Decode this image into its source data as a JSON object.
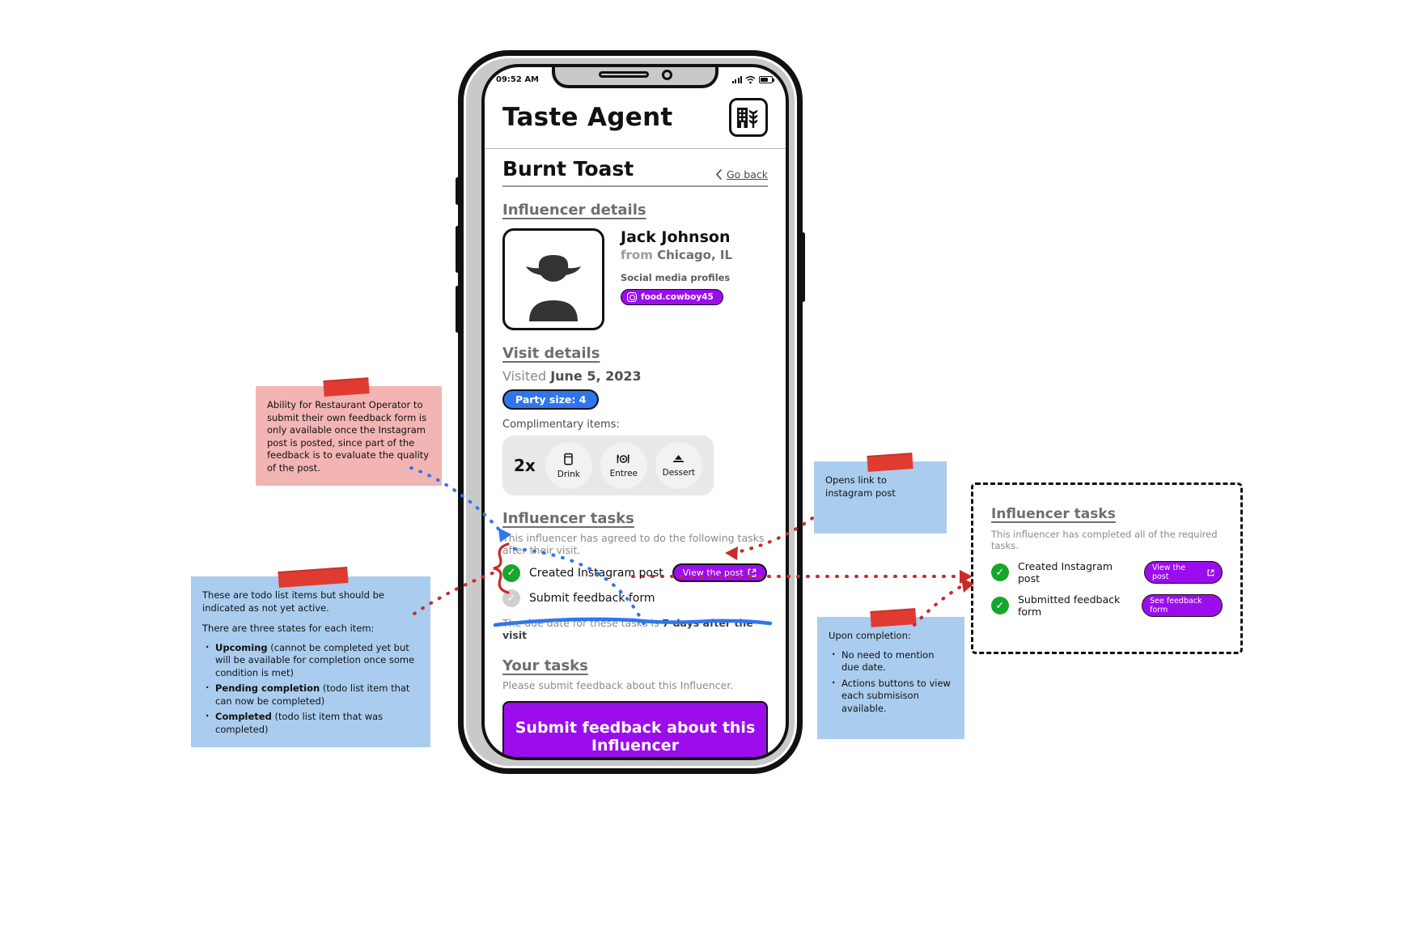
{
  "phone": {
    "status": {
      "time": "09:52 AM",
      "signal_icon": "signal-bars-icon",
      "wifi_icon": "wifi-icon",
      "battery_icon": "battery-icon"
    },
    "header": {
      "app_title": "Taste Agent",
      "logo_icon": "restaurant-logo-icon"
    },
    "page": {
      "title": "Burnt Toast",
      "back_label": "Go back",
      "back_icon": "chevron-left-icon"
    },
    "influencer": {
      "section_title": "Influencer details",
      "avatar_icon": "cowboy-avatar-icon",
      "name": "Jack Johnson",
      "from_prefix": "from ",
      "location": "Chicago, IL",
      "social_label": "Social media profiles",
      "social_handle": "food.cowboy45",
      "social_icon": "instagram-icon"
    },
    "visit": {
      "section_title": "Visit details",
      "visited_prefix": "Visited ",
      "visited_date": "June 5, 2023",
      "party_size_chip": "Party size: 4",
      "complimentary_label": "Complimentary items:",
      "quantity": "2x",
      "items": [
        {
          "label": "Drink",
          "icon": "cup-icon",
          "glyph": "🥤"
        },
        {
          "label": "Entree",
          "icon": "plate-icon",
          "glyph": "🍽"
        },
        {
          "label": "Dessert",
          "icon": "cake-slice-icon",
          "glyph": "🍰"
        }
      ]
    },
    "influencer_tasks": {
      "section_title": "Influencer tasks",
      "description": "This influencer has agreed to do the following tasks after their visit.",
      "rows": [
        {
          "label": "Created Instagram post",
          "state": "done",
          "check_icon": "check-circle-green-icon",
          "action_label": "View the post",
          "action_icon": "external-link-icon"
        },
        {
          "label": "Submit feedback form",
          "state": "todo",
          "check_icon": "check-circle-gray-icon",
          "action_label": "",
          "action_icon": ""
        }
      ],
      "due_prefix": "The due date for these tasks is ",
      "due_value": "7 days after the visit"
    },
    "your_tasks": {
      "section_title": "Your tasks",
      "description": "Please submit feedback about this Influencer.",
      "submit_label": "Submit feedback about this Influencer"
    }
  },
  "completed_panel": {
    "section_title": "Influencer tasks",
    "description": "This influencer has completed all of the required tasks.",
    "rows": [
      {
        "label": "Created Instagram post",
        "state": "done",
        "check_icon": "check-circle-green-icon",
        "action_label": "View the post",
        "action_icon": "external-link-icon"
      },
      {
        "label": "Submitted feedback form",
        "state": "done",
        "check_icon": "check-circle-green-icon",
        "action_label": "See feedback form",
        "action_icon": ""
      }
    ]
  },
  "notes": {
    "pink_feedback": {
      "text": "Ability for Restaurant Operator to submit their own feedback form is only available once the Instagram post is posted, since part of the feedback is to evaluate the quality of the post."
    },
    "blue_states": {
      "line1": "These are todo list items but should be indicated as not yet active.",
      "line2": "There are three states for each item:",
      "bullets": [
        {
          "bold": "Upcoming",
          "rest": " (cannot be completed yet but will be available for completion once some condition is met)"
        },
        {
          "bold": "Pending completion",
          "rest": " (todo list item that can now be completed)"
        },
        {
          "bold": "Completed",
          "rest": " (todo list item that was completed)"
        }
      ]
    },
    "opens_link": {
      "text": "Opens link to instagram post"
    },
    "upon_completion": {
      "title": "Upon completion:",
      "bullets": [
        "No need to mention due date.",
        "Actions buttons to view each submisison available."
      ]
    }
  },
  "colors": {
    "purple": "#9b0ded",
    "blue_chip": "#2f76ed",
    "green_check": "#16a62e",
    "gray_check": "#cfcfcf",
    "note_pink": "#f3b4b4",
    "note_blue": "#aacdef",
    "tape_red": "#e03b31"
  }
}
